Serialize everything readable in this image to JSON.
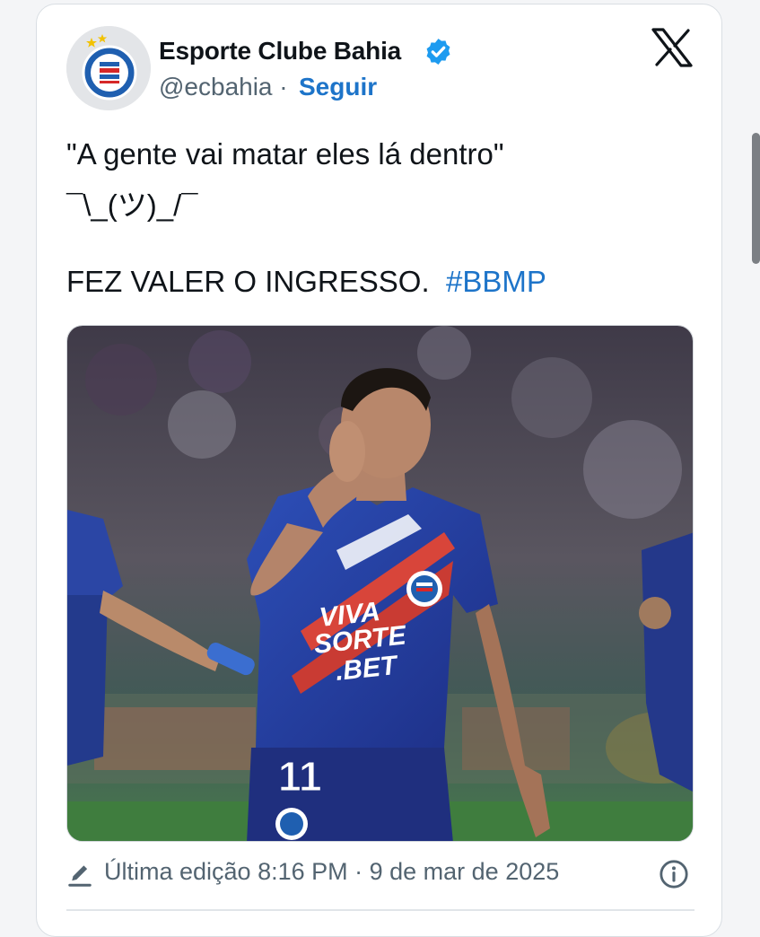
{
  "header": {
    "display_name": "Esporte Clube Bahia",
    "handle": "@ecbahia",
    "separator": "·",
    "follow_label": "Seguir",
    "avatar_icon": "bahia-crest-icon",
    "verified_icon": "verified-badge-icon",
    "platform_icon": "x-logo-icon"
  },
  "post": {
    "line1": "\"A gente vai matar eles lá dentro\"",
    "line2": "¯\\_(ツ)_/¯",
    "line3_text": "FEZ VALER O INGRESSO.",
    "hashtag": "#BBMP",
    "photo": {
      "jersey_sponsor_line1": "VIVA",
      "jersey_sponsor_line2": "SORTE",
      "jersey_sponsor_line3": ".BET",
      "jersey_number": "11"
    }
  },
  "footer": {
    "edited_label": "Última edição 8:16 PM · 9 de mar de 2025",
    "edit_icon": "pencil-icon",
    "info_icon": "info-icon"
  },
  "colors": {
    "link_blue": "#1d74c9",
    "verified_blue": "#1d9bf0",
    "text": "#0f1419",
    "muted": "#536471"
  }
}
